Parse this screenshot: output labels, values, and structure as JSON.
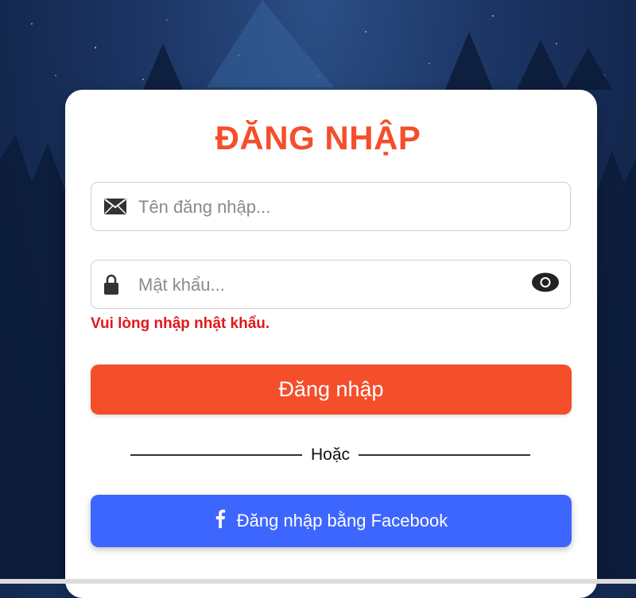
{
  "login": {
    "title": "ĐĂNG NHẬP",
    "username": {
      "placeholder": "Tên đăng nhập...",
      "value": ""
    },
    "password": {
      "placeholder": "Mật khẩu...",
      "value": ""
    },
    "error_message": "Vui lòng nhập nhật khẩu.",
    "submit_label": "Đăng nhập",
    "divider_text": "Hoặc",
    "facebook_label": "Đăng nhập bằng Facebook"
  },
  "icons": {
    "username": "envelope-icon",
    "password": "lock-icon",
    "toggle_password": "eye-icon",
    "facebook": "facebook-icon"
  },
  "colors": {
    "accent": "#f44e2b",
    "error": "#e3161a",
    "facebook": "#3d66ff",
    "background": "#1d3767"
  }
}
